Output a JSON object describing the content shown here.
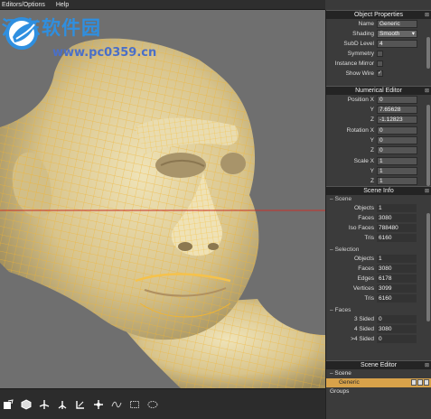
{
  "menu": {
    "items": [
      "Editors/Options",
      "Help"
    ]
  },
  "watermark": {
    "title": "河东软件园",
    "url": "www.pc0359.cn"
  },
  "object_properties": {
    "header": "Object Properties",
    "rows": [
      {
        "label": "Name",
        "value": "Generic"
      },
      {
        "label": "Shading",
        "value": "Smooth"
      },
      {
        "label": "SubD Level",
        "value": "4"
      }
    ],
    "checks": [
      {
        "label": "Symmetry",
        "checked": false
      },
      {
        "label": "Instance Mirror",
        "checked": false
      },
      {
        "label": "Show Wire",
        "checked": true
      }
    ]
  },
  "numerical_editor": {
    "header": "Numerical Editor",
    "position": {
      "label": "Position X",
      "x": "0",
      "y_label": "Y",
      "y": "7.65628",
      "z_label": "Z",
      "z": "-1.12823"
    },
    "rotation": {
      "label": "Rotation X",
      "x": "0",
      "y_label": "Y",
      "y": "0",
      "z_label": "Z",
      "z": "0"
    },
    "scale": {
      "label": "Scale X",
      "x": "1",
      "y_label": "Y",
      "y": "1",
      "z_label": "Z",
      "z": "1"
    }
  },
  "scene_info": {
    "header": "Scene Info",
    "scene": {
      "label": "Scene",
      "rows": [
        {
          "label": "Objects",
          "value": "1"
        },
        {
          "label": "Faces",
          "value": "3080"
        },
        {
          "label": "Iso Faces",
          "value": "788480"
        },
        {
          "label": "Tris",
          "value": "6160"
        }
      ]
    },
    "selection": {
      "label": "Selection",
      "rows": [
        {
          "label": "Objects",
          "value": "1"
        },
        {
          "label": "Faces",
          "value": "3080"
        },
        {
          "label": "Edges",
          "value": "6178"
        },
        {
          "label": "Vertices",
          "value": "3099"
        },
        {
          "label": "Tris",
          "value": "6160"
        }
      ]
    },
    "faces": {
      "label": "Faces",
      "rows": [
        {
          "label": "3 Sided",
          "value": "0"
        },
        {
          "label": "4 Sided",
          "value": "3080"
        },
        {
          "label": ">4 Sided",
          "value": "0"
        }
      ]
    }
  },
  "scene_editor": {
    "header": "Scene Editor",
    "scene_label": "Scene",
    "selected_item": "Generic",
    "groups_label": "Groups"
  },
  "icons": [
    "close-icon",
    "dropdown-icon",
    "sculpt-tool-icon",
    "move-tool-icon",
    "lasso-select-icon"
  ],
  "colors": {
    "accent": "#d8a24a",
    "wire": "#f0b432",
    "mesh": "#e5d6a5",
    "guide_line": "#c83228"
  }
}
